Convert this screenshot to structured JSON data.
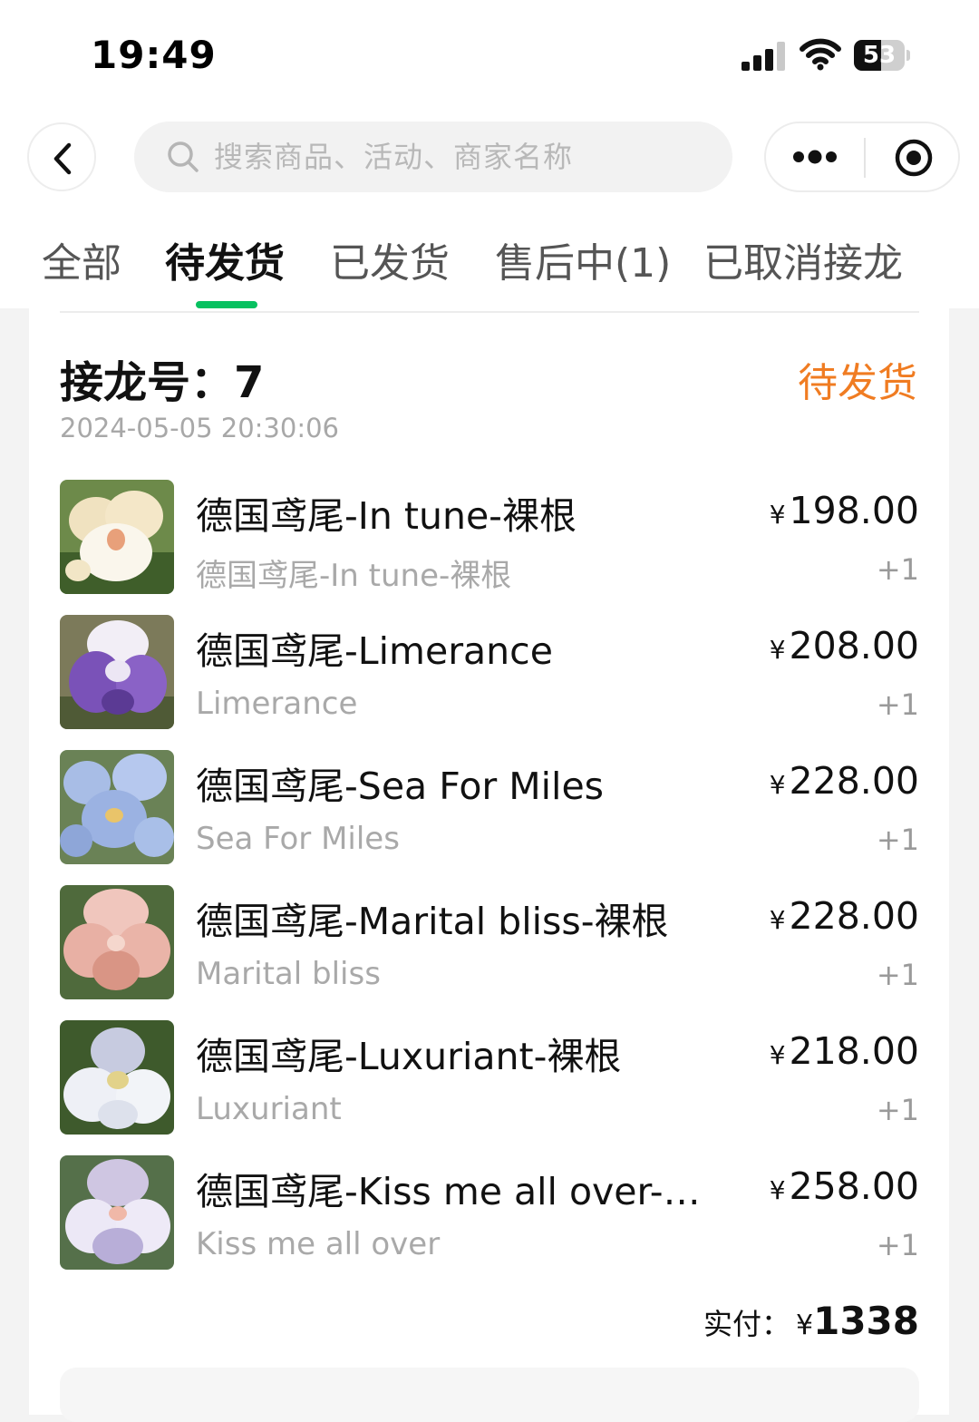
{
  "status_bar": {
    "time": "19:49",
    "battery": "53",
    "battery_level_percent": 53
  },
  "nav": {
    "search_placeholder": "搜索商品、活动、商家名称"
  },
  "tabs": [
    {
      "label": "全部",
      "active": false
    },
    {
      "label": "待发货",
      "active": true
    },
    {
      "label": "已发货",
      "active": false
    },
    {
      "label": "售后中(1)",
      "active": false
    },
    {
      "label": "已取消接龙",
      "active": false
    }
  ],
  "colors": {
    "accent_green": "#07c160",
    "status_orange": "#f07c22"
  },
  "order": {
    "title": "接龙号：7",
    "status": "待发货",
    "time": "2024-05-05 20:30:06",
    "items": [
      {
        "name": "德国鸢尾-In tune-裸根",
        "spec": "德国鸢尾-In tune-裸根",
        "currency": "¥",
        "price": "198.00",
        "qty": "+1"
      },
      {
        "name": "德国鸢尾-Limerance",
        "spec": "Limerance",
        "currency": "¥",
        "price": "208.00",
        "qty": "+1"
      },
      {
        "name": "德国鸢尾-Sea For Miles",
        "spec": "Sea For Miles",
        "currency": "¥",
        "price": "228.00",
        "qty": "+1"
      },
      {
        "name": "德国鸢尾-Marital bliss-裸根",
        "spec": "Marital bliss",
        "currency": "¥",
        "price": "228.00",
        "qty": "+1"
      },
      {
        "name": "德国鸢尾-Luxuriant-裸根",
        "spec": "Luxuriant",
        "currency": "¥",
        "price": "218.00",
        "qty": "+1"
      },
      {
        "name": "德国鸢尾-Kiss me all over-…",
        "spec": "Kiss me all over",
        "currency": "¥",
        "price": "258.00",
        "qty": "+1"
      }
    ],
    "total_label": "实付：",
    "total_currency": "¥",
    "total_value": "1338"
  }
}
